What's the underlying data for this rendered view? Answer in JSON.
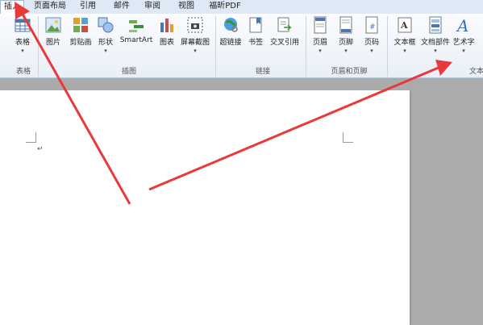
{
  "tabs": [
    "插入",
    "页面布局",
    "引用",
    "邮件",
    "审阅",
    "视图",
    "福昕PDF"
  ],
  "ribbon": {
    "buttons": [
      "表格",
      "图片",
      "剪贴画",
      "形状",
      "SmartArt",
      "图表",
      "屏幕截图",
      "超链接",
      "书签",
      "交叉引用",
      "页眉",
      "页脚",
      "页码",
      "文本框",
      "文档部件",
      "艺术字"
    ],
    "groups": [
      "表格",
      "插图",
      "链接",
      "页眉和页脚",
      "文本"
    ]
  },
  "document": {
    "paragraph_mark": "↵"
  },
  "annotation": {
    "arrow_color": "#e83a3a"
  }
}
